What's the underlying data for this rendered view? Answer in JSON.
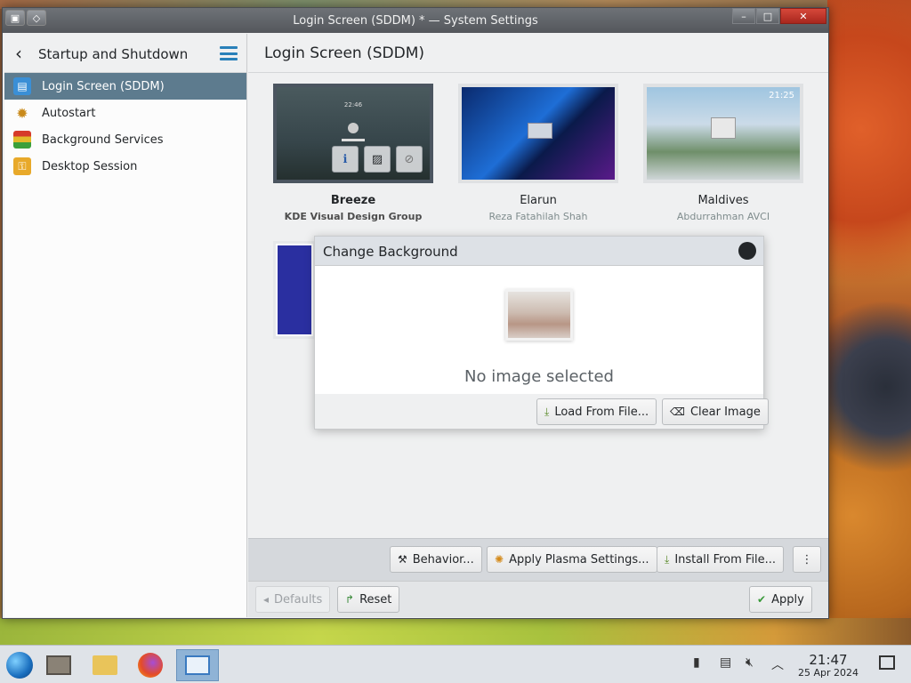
{
  "window": {
    "title": "Login Screen (SDDM) * — System Settings",
    "close_icon": "✕",
    "maximize_icon": "□",
    "minimize_icon": "–"
  },
  "sidebar": {
    "title": "Startup and Shutdown",
    "back_icon": "‹",
    "items": [
      {
        "label": "Login Screen (SDDM)",
        "icon": "login-screen-icon",
        "active": true
      },
      {
        "label": "Autostart",
        "icon": "autostart-icon",
        "active": false
      },
      {
        "label": "Background Services",
        "icon": "background-services-icon",
        "active": false
      },
      {
        "label": "Desktop Session",
        "icon": "desktop-session-icon",
        "active": false
      }
    ]
  },
  "main": {
    "title": "Login Screen (SDDM)",
    "themes": [
      {
        "name": "Breeze",
        "author": "KDE Visual Design Group",
        "selected": true
      },
      {
        "name": "Elarun",
        "author": "Reza Fatahilah Shah",
        "selected": false
      },
      {
        "name": "Maldives",
        "author": "Abdurrahman AVCI",
        "selected": false
      }
    ],
    "breeze_thumb": {
      "time": "22:46"
    },
    "maldives_thumb": {
      "time": "21:25"
    }
  },
  "dialog": {
    "title": "Change Background",
    "empty_text": "No image selected",
    "load_label": "Load From File...",
    "clear_label": "Clear Image"
  },
  "actions": {
    "behavior_label": "Behavior...",
    "apply_plasma_label": "Apply Plasma Settings...",
    "install_label": "Install From File...",
    "more_icon": "⋮"
  },
  "footer": {
    "defaults_label": "Defaults",
    "reset_label": "Reset",
    "apply_label": "Apply"
  },
  "taskbar": {
    "time": "21:47",
    "date": "25 Apr 2024"
  },
  "colors": {
    "accent": "#2980b9",
    "sidebar_active": "#5d7b8e"
  }
}
